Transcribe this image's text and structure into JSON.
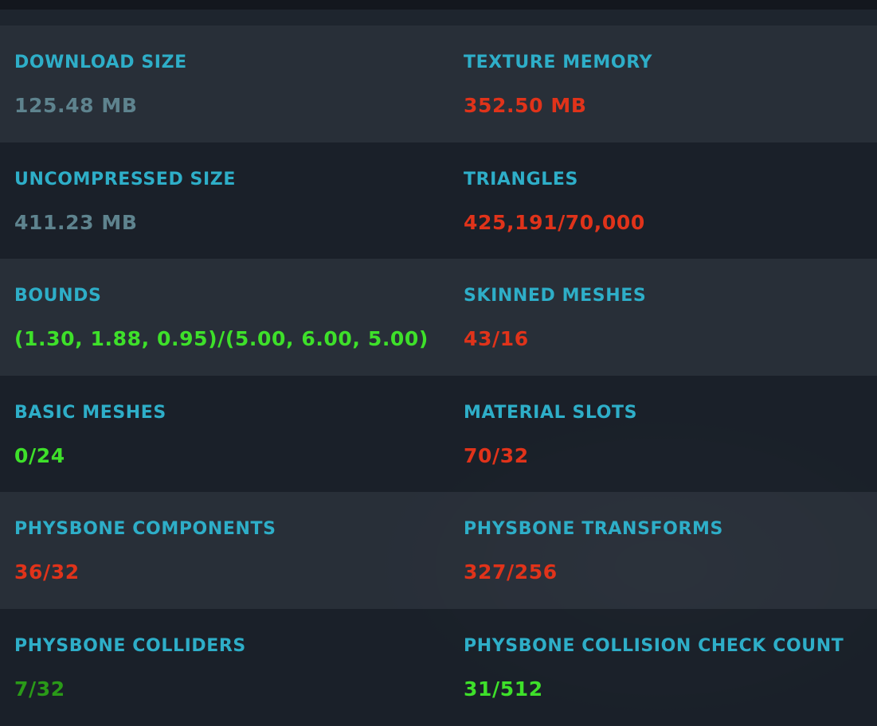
{
  "colors": {
    "label": "#2eaec8",
    "neutral": "#5e838e",
    "bad": "#e0331a",
    "good": "#3ee02a",
    "good_dim": "#2a9a18"
  },
  "stats": [
    {
      "left": {
        "label": "DOWNLOAD SIZE",
        "value": "125.48 MB",
        "status": "neutral"
      },
      "right": {
        "label": "TEXTURE MEMORY",
        "value": "352.50 MB",
        "status": "bad"
      }
    },
    {
      "left": {
        "label": "UNCOMPRESSED SIZE",
        "value": "411.23 MB",
        "status": "neutral"
      },
      "right": {
        "label": "TRIANGLES",
        "value": "425,191/70,000",
        "status": "bad"
      }
    },
    {
      "left": {
        "label": "BOUNDS",
        "value": "(1.30, 1.88, 0.95)/(5.00, 6.00, 5.00)",
        "status": "good"
      },
      "right": {
        "label": "SKINNED MESHES",
        "value": "43/16",
        "status": "bad"
      }
    },
    {
      "left": {
        "label": "BASIC MESHES",
        "value": "0/24",
        "status": "good"
      },
      "right": {
        "label": "MATERIAL SLOTS",
        "value": "70/32",
        "status": "bad"
      }
    },
    {
      "left": {
        "label": "PHYSBONE COMPONENTS",
        "value": "36/32",
        "status": "bad"
      },
      "right": {
        "label": "PHYSBONE TRANSFORMS",
        "value": "327/256",
        "status": "bad"
      }
    },
    {
      "left": {
        "label": "PHYSBONE COLLIDERS",
        "value": "7/32",
        "status": "good_dim"
      },
      "right": {
        "label": "PHYSBONE COLLISION CHECK COUNT",
        "value": "31/512",
        "status": "good"
      }
    }
  ]
}
